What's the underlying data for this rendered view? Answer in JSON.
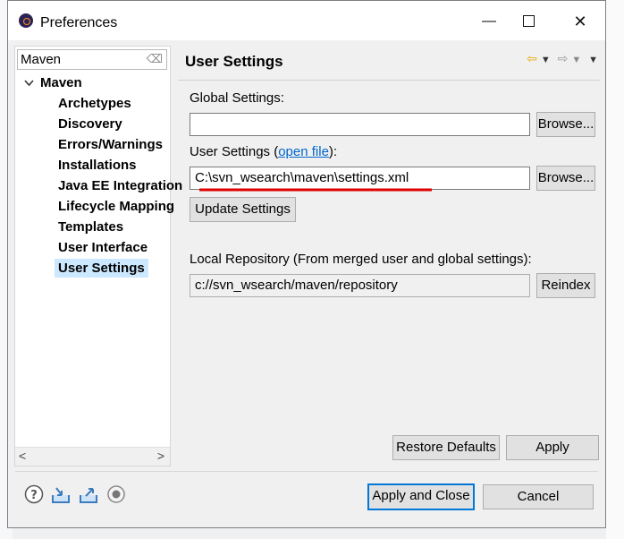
{
  "dialog": {
    "title": "Preferences",
    "window_buttons": {
      "minimize": "—",
      "close": "✕"
    }
  },
  "filter": {
    "value": "Maven",
    "clear_icon": "⌫"
  },
  "tree": {
    "parent": "Maven",
    "children": [
      "Archetypes",
      "Discovery",
      "Errors/Warnings",
      "Installations",
      "Java EE Integration",
      "Lifecycle Mapping",
      "Templates",
      "User Interface",
      "User Settings"
    ],
    "selected": "User Settings"
  },
  "scroll_arrows": {
    "left": "<",
    "right": ">"
  },
  "page": {
    "title": "User Settings",
    "nav": {
      "back": "⇦",
      "forward": "⇨",
      "drop": "▼"
    },
    "global_settings_label": "Global Settings:",
    "global_settings_value": "",
    "browse_label": "Browse...",
    "user_settings_label": "User Settings (",
    "open_file_link": "open file",
    "user_settings_label_end": "):",
    "user_settings_value": "C:\\svn_wsearch\\maven\\settings.xml",
    "update_settings_label": "Update Settings",
    "local_repo_label": "Local Repository (From merged user and global settings):",
    "local_repo_value": "c://svn_wsearch/maven/repository",
    "reindex_label": "Reindex",
    "restore_defaults_label": "Restore Defaults",
    "apply_label": "Apply"
  },
  "footer": {
    "apply_close_label": "Apply and Close",
    "cancel_label": "Cancel"
  },
  "colors": {
    "selection": "#cce8ff",
    "link": "#0066cc",
    "underline_mark": "#e00000",
    "primary_border": "#0078d7"
  }
}
